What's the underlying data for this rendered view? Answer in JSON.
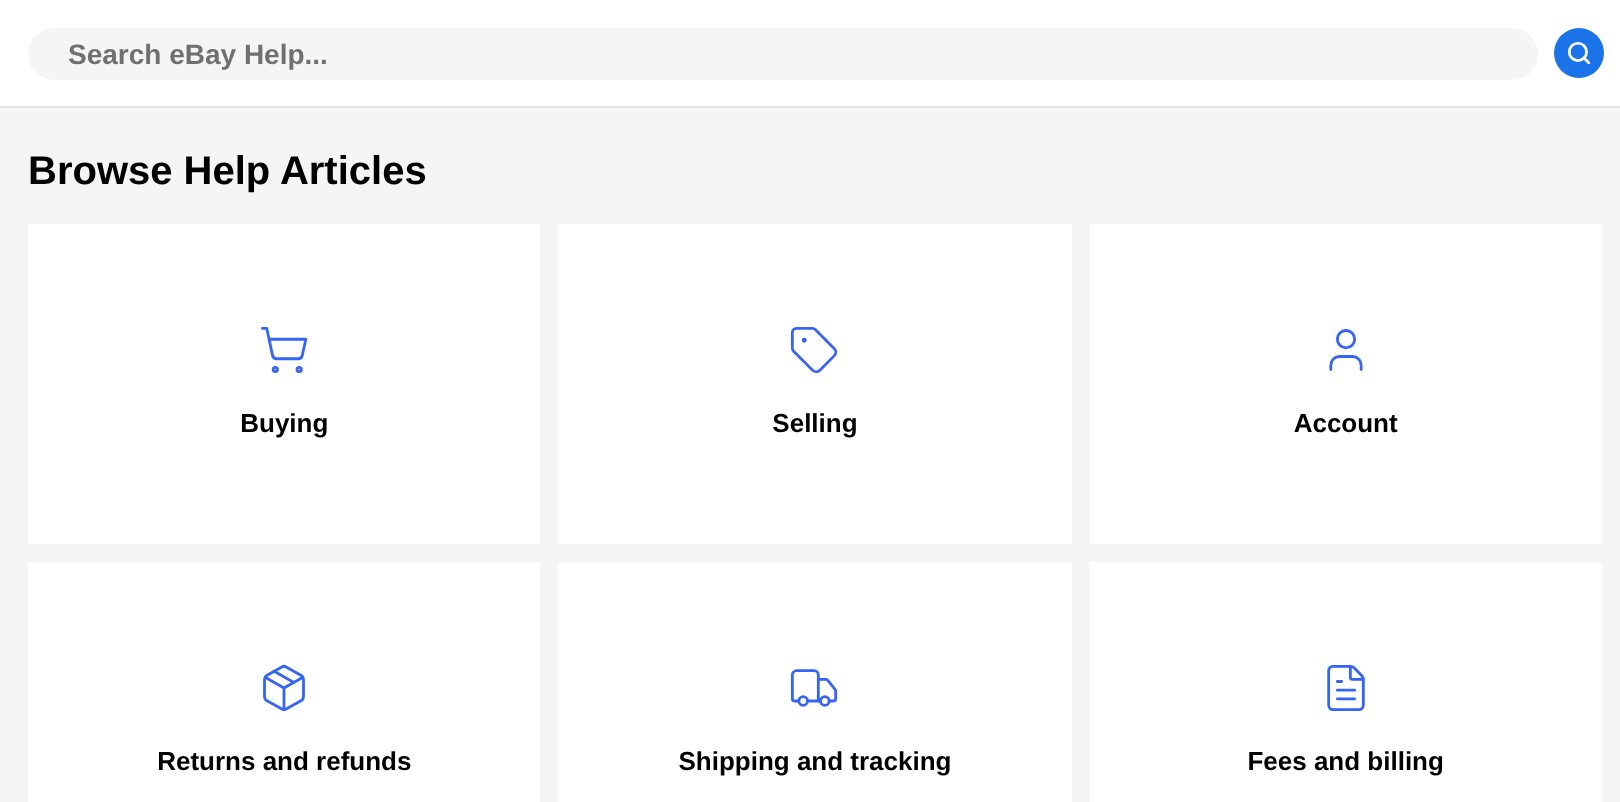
{
  "search": {
    "placeholder": "Search eBay Help..."
  },
  "heading": "Browse Help Articles",
  "categories": [
    {
      "kind": "cart",
      "label": "Buying"
    },
    {
      "kind": "tag",
      "label": "Selling"
    },
    {
      "kind": "user",
      "label": "Account"
    },
    {
      "kind": "box",
      "label": "Returns and refunds"
    },
    {
      "kind": "truck",
      "label": "Shipping and tracking"
    },
    {
      "kind": "document",
      "label": "Fees and billing"
    }
  ]
}
